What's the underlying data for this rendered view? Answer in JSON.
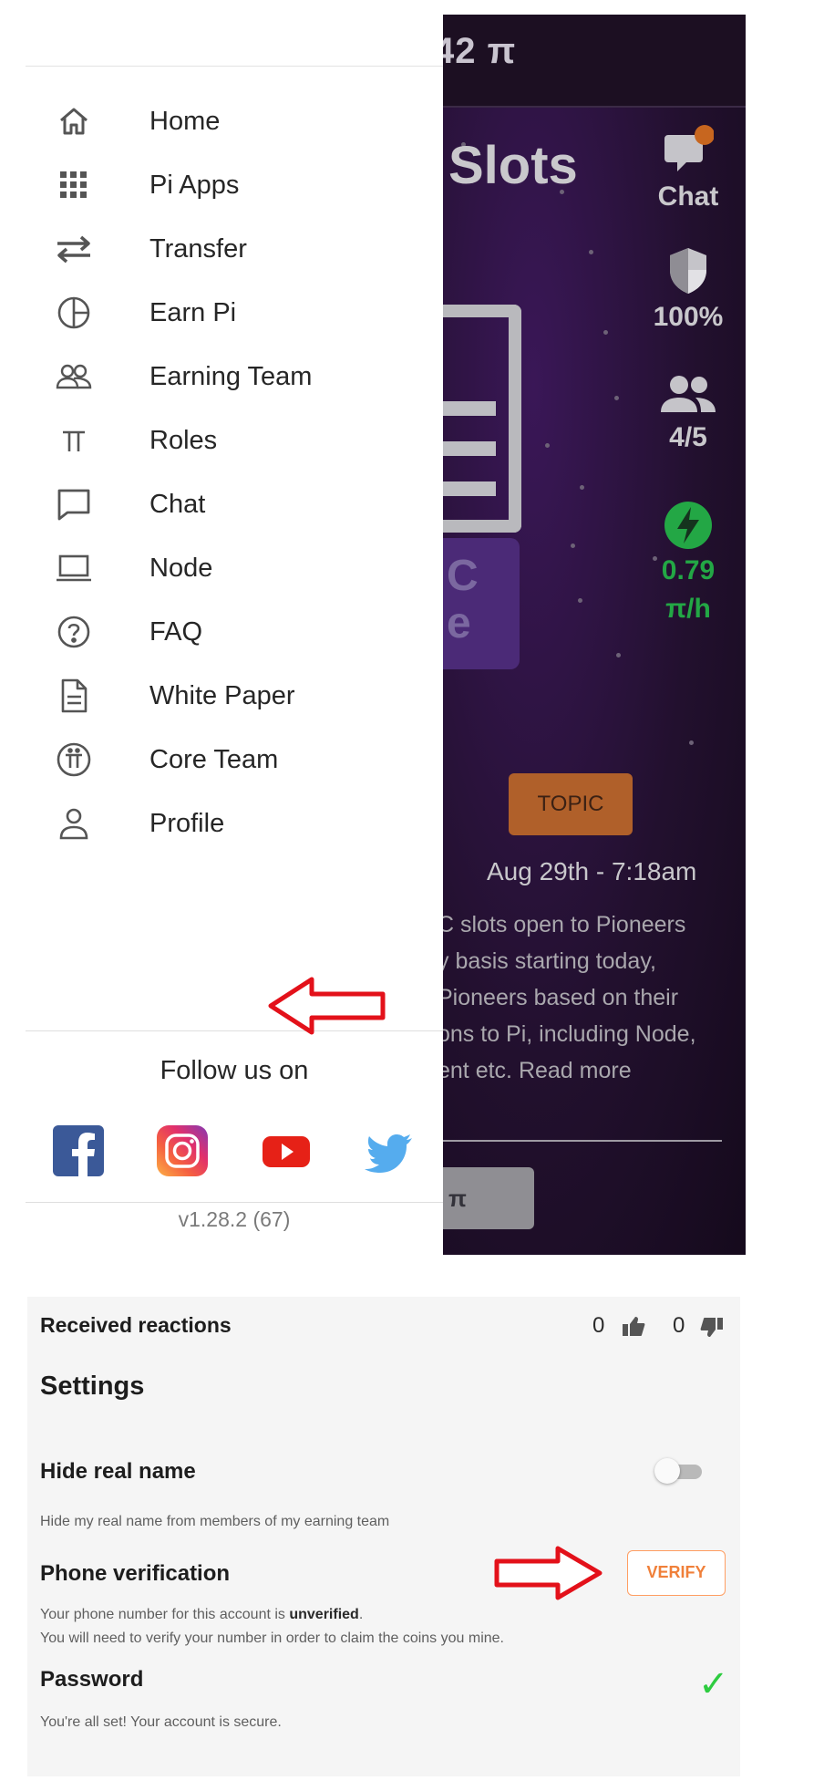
{
  "background_app": {
    "balance": "42 π",
    "title": "Slots",
    "chat_label": "Chat",
    "security": "100%",
    "team_count": "4/5",
    "rate_value": "0.79",
    "rate_unit": "π/h",
    "purple_block_top": "C",
    "purple_block_bottom": "e",
    "topic_label": "TOPIC",
    "post_date": "Aug 29th - 7:18am",
    "post_lines": [
      "C slots open to Pioneers",
      "y basis starting today,",
      "Pioneers based on their",
      "ons to Pi, including Node,",
      "ent etc. Read more"
    ],
    "button_fragment": "π",
    "colors": {
      "accent_green": "#23a745",
      "topic_orange": "#b0602a",
      "chat_dot": "#c7661f"
    }
  },
  "drawer": {
    "menu": [
      {
        "label": "Home",
        "icon": "home-icon"
      },
      {
        "label": "Pi Apps",
        "icon": "grid-icon"
      },
      {
        "label": "Transfer",
        "icon": "transfer-icon"
      },
      {
        "label": "Earn Pi",
        "icon": "pie-chart-icon"
      },
      {
        "label": "Earning Team",
        "icon": "team-icon"
      },
      {
        "label": "Roles",
        "icon": "pi-icon"
      },
      {
        "label": "Chat",
        "icon": "chat-icon"
      },
      {
        "label": "Node",
        "icon": "laptop-icon"
      },
      {
        "label": "FAQ",
        "icon": "help-icon"
      },
      {
        "label": "White Paper",
        "icon": "document-icon"
      },
      {
        "label": "Core Team",
        "icon": "pi-circle-icon"
      },
      {
        "label": "Profile",
        "icon": "person-icon"
      }
    ],
    "follow_label": "Follow us on",
    "social": [
      "facebook-icon",
      "instagram-icon",
      "youtube-icon",
      "twitter-icon"
    ],
    "version": "v1.28.2 (67)"
  },
  "settings": {
    "received_reactions_label": "Received reactions",
    "likes": "0",
    "dislikes": "0",
    "section_title": "Settings",
    "hide_real_name": {
      "label": "Hide real name",
      "desc": "Hide my real name from members of my earning team",
      "enabled": false
    },
    "phone_verification": {
      "label": "Phone verification",
      "desc_prefix": "Your phone number for this account is ",
      "status": "unverified",
      "desc_suffix": ".",
      "desc_line2": "You will need to verify your number in order to claim the coins you mine.",
      "button": "VERIFY"
    },
    "password": {
      "label": "Password",
      "desc": "You're all set! Your account is secure.",
      "status_icon": "checkmark-icon"
    }
  }
}
